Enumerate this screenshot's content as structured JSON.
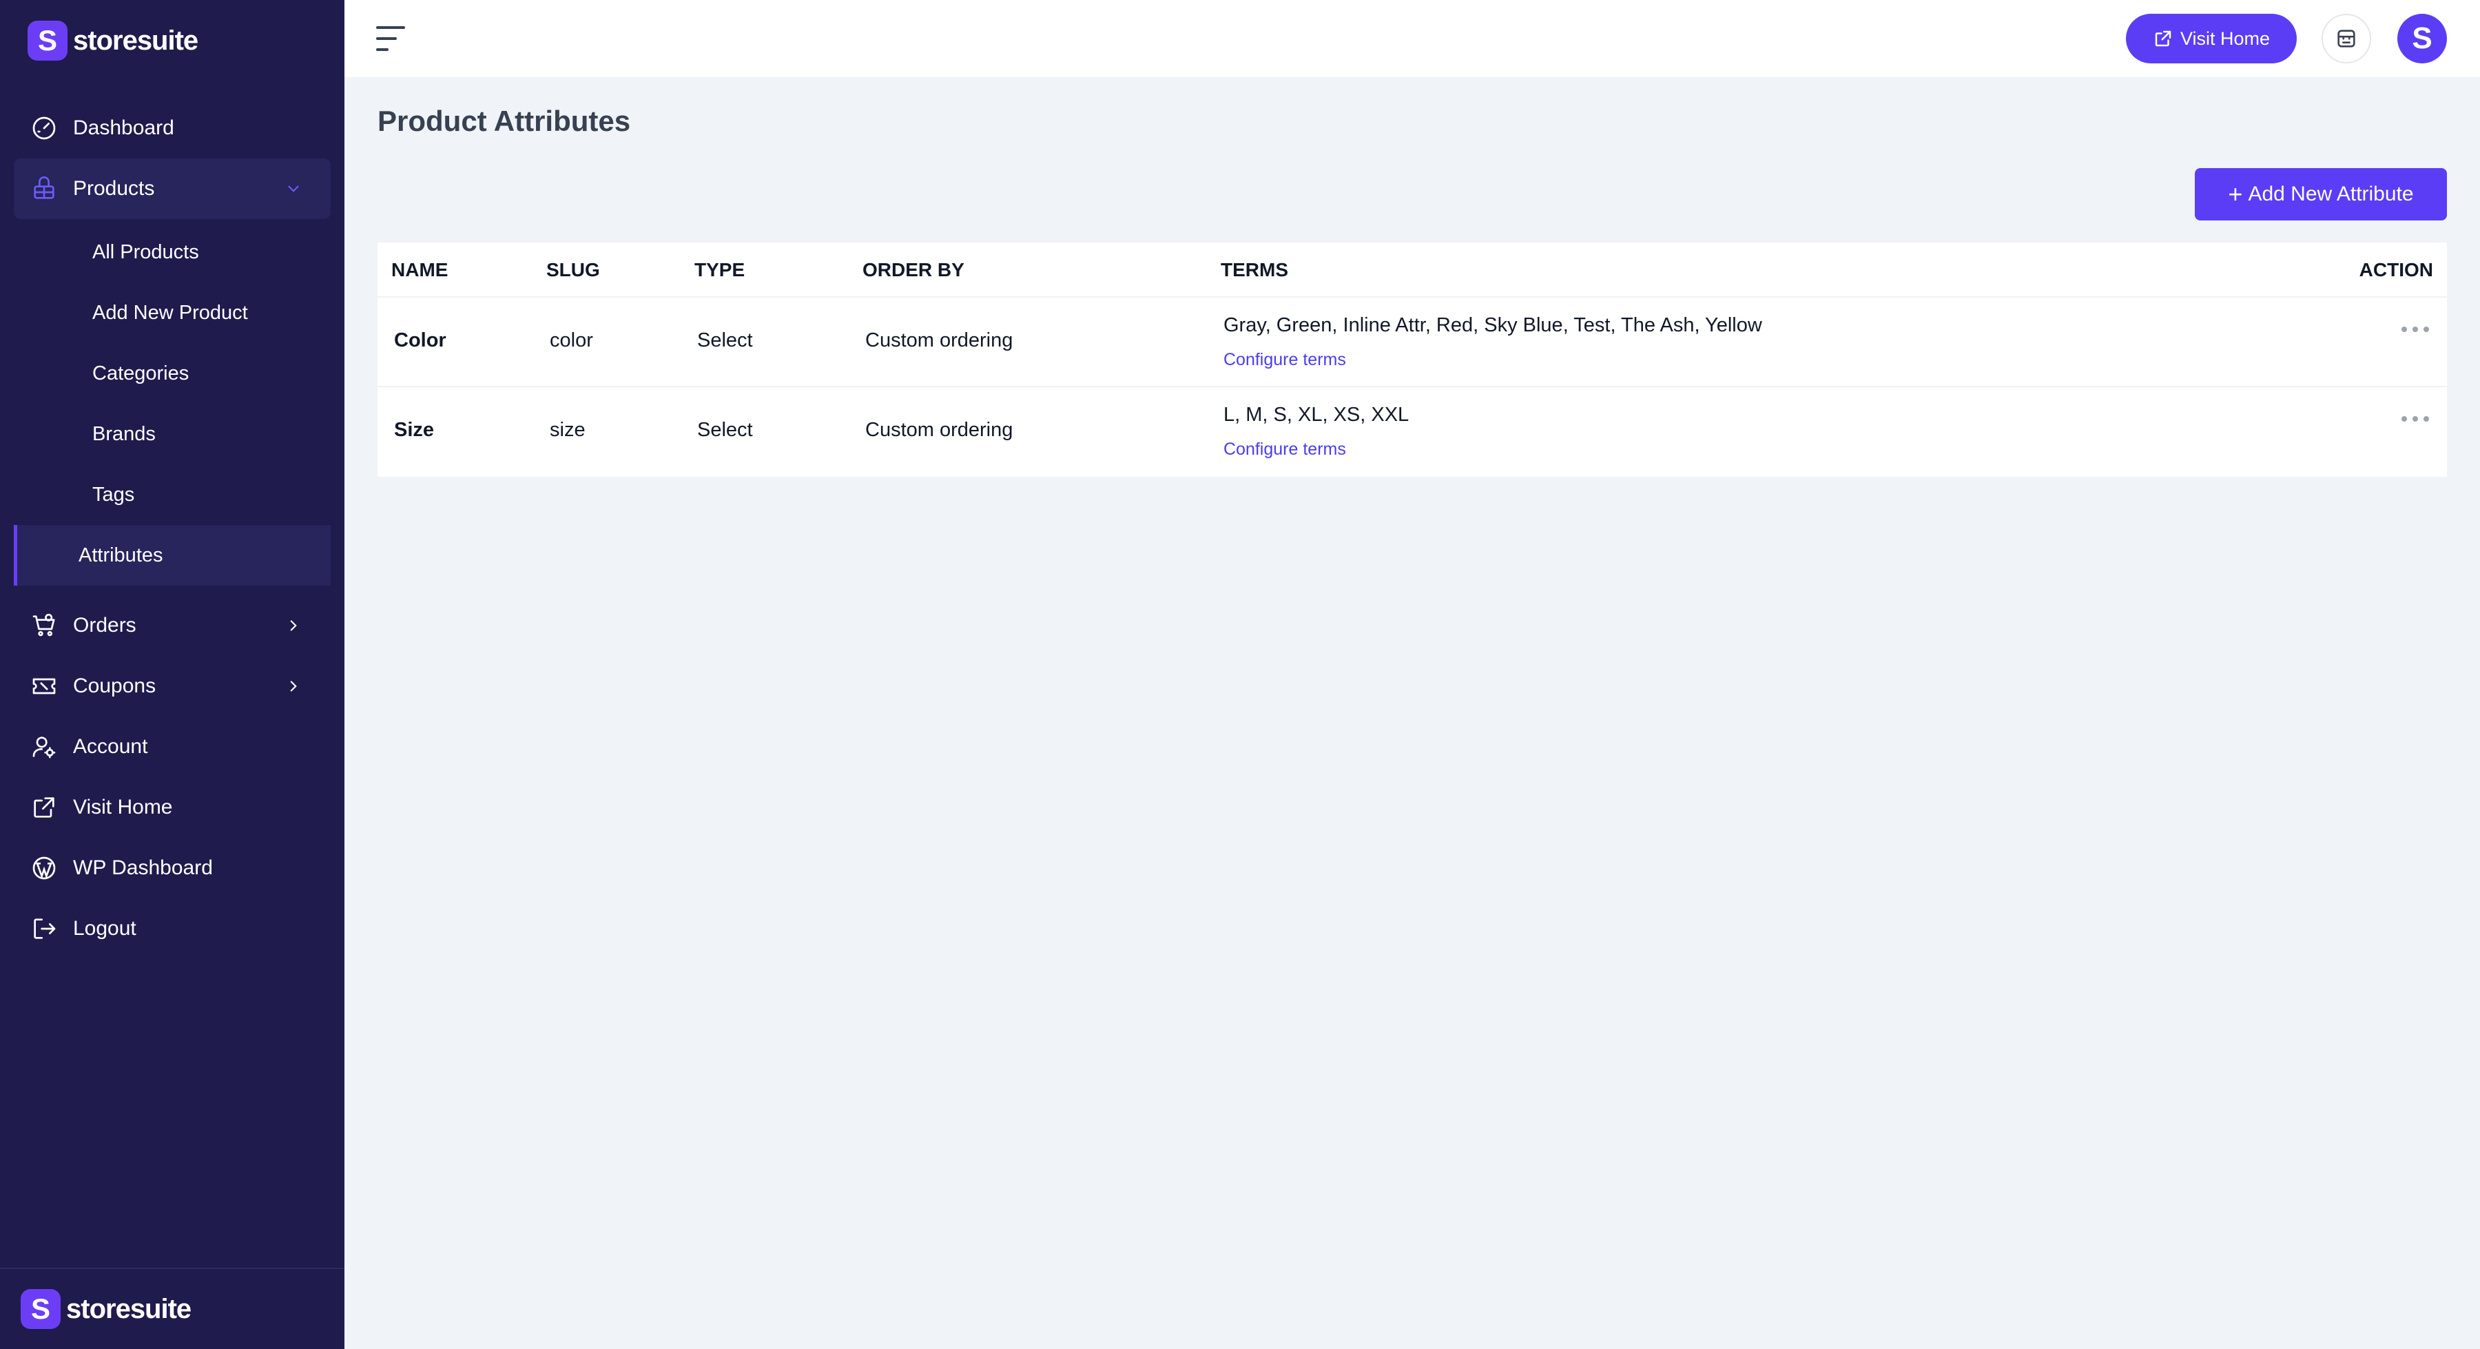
{
  "brand": {
    "name": "storesuite",
    "mark": "S"
  },
  "sidebar": {
    "items": [
      {
        "label": "Dashboard",
        "icon": "gauge-icon"
      },
      {
        "label": "Products",
        "icon": "box-icon",
        "expanded": true,
        "children": [
          "All Products",
          "Add New Product",
          "Categories",
          "Brands",
          "Tags",
          "Attributes"
        ],
        "current_child": "Attributes"
      },
      {
        "label": "Orders",
        "icon": "cart-icon"
      },
      {
        "label": "Coupons",
        "icon": "ticket-icon"
      },
      {
        "label": "Account",
        "icon": "user-gear-icon"
      },
      {
        "label": "Visit Home",
        "icon": "external-link-icon"
      },
      {
        "label": "WP Dashboard",
        "icon": "wordpress-icon"
      },
      {
        "label": "Logout",
        "icon": "logout-icon"
      }
    ]
  },
  "topbar": {
    "visit_home_label": "Visit Home",
    "avatar_initial": "S"
  },
  "page": {
    "title": "Product Attributes",
    "add_button_label": "Add New Attribute"
  },
  "table": {
    "headers": {
      "name": "NAME",
      "slug": "SLUG",
      "type": "TYPE",
      "order_by": "ORDER BY",
      "terms": "TERMS",
      "action": "ACTION"
    },
    "rows": [
      {
        "name": "Color",
        "slug": "color",
        "type": "Select",
        "order_by": "Custom ordering",
        "terms": "Gray, Green, Inline Attr, Red, Sky Blue, Test, The Ash, Yellow",
        "configure": "Configure terms"
      },
      {
        "name": "Size",
        "slug": "size",
        "type": "Select",
        "order_by": "Custom ordering",
        "terms": "L, M, S, XL, XS, XXL",
        "configure": "Configure terms"
      }
    ]
  },
  "colors": {
    "sidebar_bg": "#1f1b4d",
    "accent": "#5b3df5",
    "page_bg": "#f0f3f7"
  }
}
